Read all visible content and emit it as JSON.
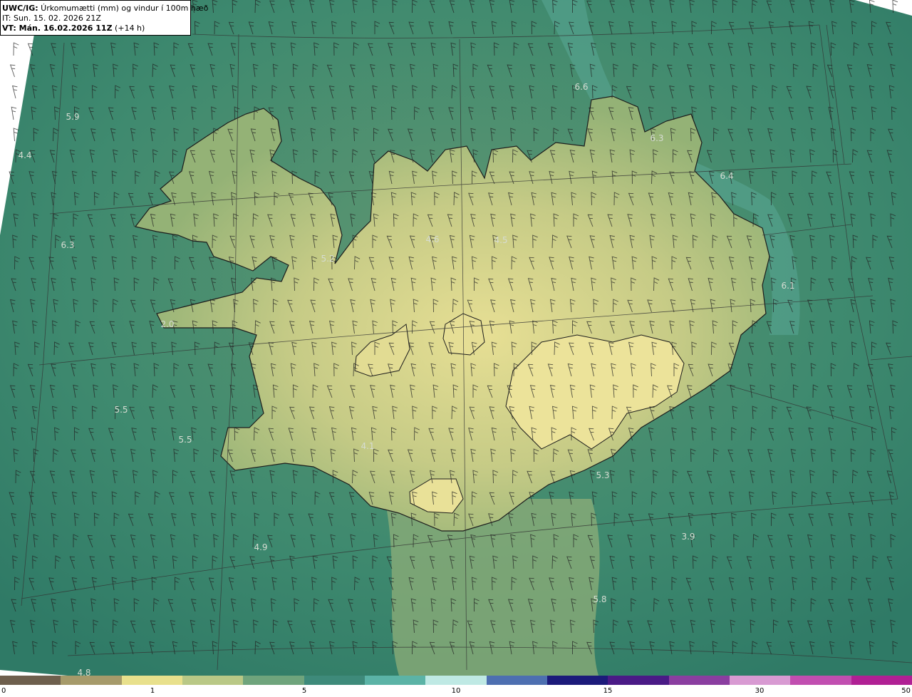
{
  "header": {
    "model": "UWC/IG:",
    "title": " Úrkomumætti (mm) og vindur í 100m hæð",
    "it_line": "IT: Sun. 15. 02. 2026 21Z",
    "vt_label": "VT: Mán. 16.02.2026 11Z",
    "vt_offset": " (+14 h)"
  },
  "map_labels": [
    "6.6",
    "5.9",
    "4.4",
    "6.3",
    "6.4",
    "6.3",
    "4.6",
    "4.5",
    "5.2",
    "6.1",
    "2.0",
    "5.5",
    "5.5",
    "4.1",
    "5.3",
    "4.9",
    "3.9",
    "5.8",
    "4.8"
  ],
  "colorbar": {
    "ticks": [
      "0",
      "1",
      "5",
      "10",
      "15",
      "30",
      "50"
    ],
    "colors": [
      "#6e5f4d",
      "#a69a6a",
      "#e8e08c",
      "#b9c886",
      "#6fa47c",
      "#3e8a7a",
      "#5bb3a6",
      "#bfe9e4",
      "#4d6fb0",
      "#1c1a7a",
      "#4a1a86",
      "#8a3ea0",
      "#d89ad2",
      "#c14eb0",
      "#b02094"
    ]
  },
  "colors": {
    "sea": "#3f8a6f",
    "land_low": "#a9bf7e",
    "land_high": "#e6df95",
    "coast": "#1c1c1c",
    "barb": "#222222"
  }
}
